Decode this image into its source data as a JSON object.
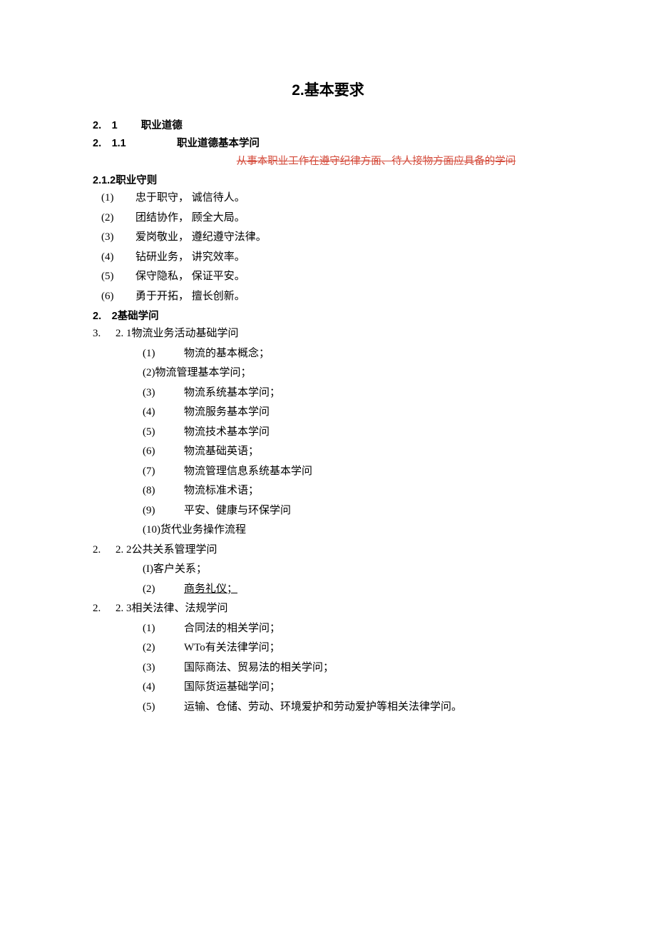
{
  "title": "2.基本要求",
  "sec_21_num": "2.　1",
  "sec_21_label": "职业道德",
  "sec_211_num": "2.　1.1",
  "sec_211_label": "职业道德基本学问",
  "red_text": "从事本职业工作在遵守纪律方面、待人接物方面应具备的学问",
  "sec_212": "2.1.2职业守则",
  "rules": [
    {
      "n": "(1)",
      "t": "忠于职守，  诚信待人。"
    },
    {
      "n": "(2)",
      "t": "团结协作，  顾全大局。"
    },
    {
      "n": "(3)",
      "t": "爱岗敬业，  遵纪遵守法律。"
    },
    {
      "n": "(4)",
      "t": "钻研业务，  讲究效率。"
    },
    {
      "n": "(5)",
      "t": "保守隐私，  保证平安。"
    },
    {
      "n": "(6)",
      "t": "勇于开拓，  擅长创新。"
    }
  ],
  "sec_22_num": "2.　2基础学问",
  "sec_221_prefix": "3.",
  "sec_221_text": "2. 1物流业务活动基础学问",
  "list_221": [
    {
      "n": "(1)",
      "t": "物流的基本概念；",
      "type": "num"
    },
    {
      "n": "",
      "t": "(2)物流管理基本学问；",
      "type": "tight"
    },
    {
      "n": "(3)",
      "t": "物流系统基本学问；",
      "type": "num"
    },
    {
      "n": "(4)",
      "t": "物流服务基本学问",
      "type": "num"
    },
    {
      "n": "(5)",
      "t": "物流技术基本学问",
      "type": "num"
    },
    {
      "n": "(6)",
      "t": "物流基础英语；",
      "type": "num"
    },
    {
      "n": "(7)",
      "t": "物流管理信息系统基本学问",
      "type": "num"
    },
    {
      "n": "(8)",
      "t": "物流标准术语；",
      "type": "num"
    },
    {
      "n": "(9)",
      "t": "平安、健康与环保学问",
      "type": "num"
    },
    {
      "n": "",
      "t": "(10)货代业务操作流程",
      "type": "tight"
    }
  ],
  "sec_222_prefix": "2.",
  "sec_222_text": "2. 2公共关系管理学问",
  "list_222_item1": "(I)客户关系；",
  "list_222_item2_n": "(2)",
  "list_222_item2_t": "商务礼仪；",
  "sec_223_prefix": "2.",
  "sec_223_text": "2. 3相关法律、法规学问",
  "list_223": [
    {
      "n": "(1)",
      "t": "合同法的相关学问；"
    },
    {
      "n": "(2)",
      "t": "WTo有关法律学问；"
    },
    {
      "n": "(3)",
      "t": "国际商法、贸易法的相关学问；"
    },
    {
      "n": "(4)",
      "t": "国际货运基础学问；"
    },
    {
      "n": "(5)",
      "t": "运输、仓储、劳动、环境爱护和劳动爱护等相关法律学问。"
    }
  ]
}
